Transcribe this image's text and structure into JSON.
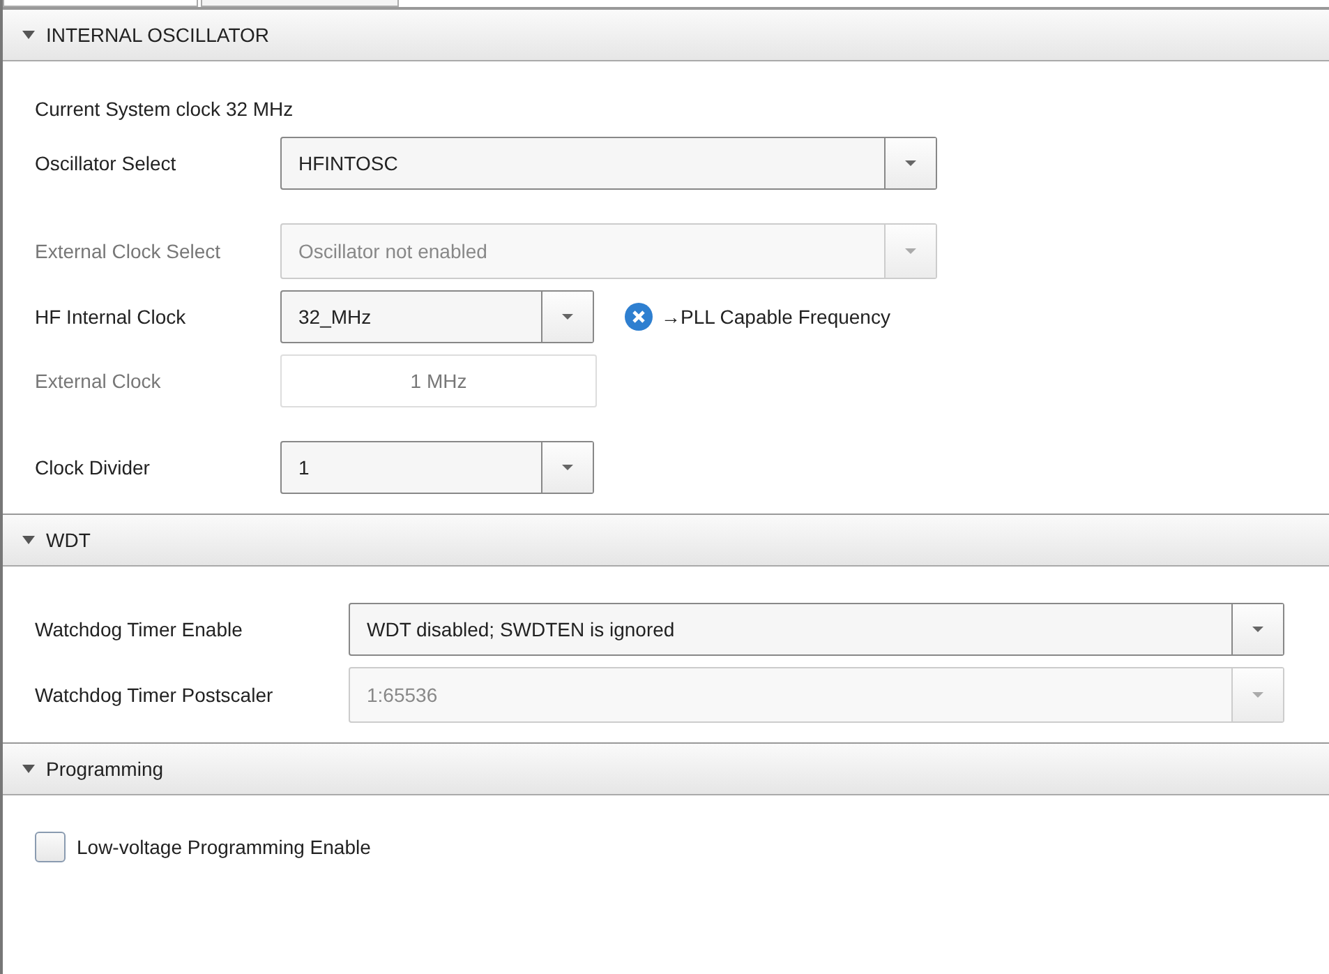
{
  "sections": [
    {
      "title": "INTERNAL OSCILLATOR",
      "expanded": true,
      "rows": [
        {
          "kind": "text",
          "label": "Current System clock",
          "value": "32 MHz"
        },
        {
          "kind": "combo",
          "label": "Oscillator Select",
          "value": "HFINTOSC",
          "disabled": false,
          "label_disabled": false
        },
        {
          "kind": "spacer"
        },
        {
          "kind": "combo",
          "label": "External Clock Select",
          "value": "Oscillator not enabled",
          "disabled": true,
          "label_disabled": true
        },
        {
          "kind": "combo",
          "label": "HF Internal Clock",
          "value": "32_MHz",
          "disabled": false,
          "label_disabled": false,
          "note": "→PLL Capable Frequency"
        },
        {
          "kind": "input",
          "label": "External Clock",
          "value": "1 MHz",
          "disabled": true,
          "label_disabled": true
        },
        {
          "kind": "spacer"
        },
        {
          "kind": "combo",
          "label": "Clock Divider",
          "value": "1",
          "disabled": false,
          "label_disabled": false
        }
      ]
    },
    {
      "title": "WDT",
      "expanded": true,
      "rows": [
        {
          "kind": "spacer"
        },
        {
          "kind": "combo",
          "label": "Watchdog Timer Enable",
          "value": "WDT disabled; SWDTEN is ignored",
          "disabled": false,
          "label_disabled": false
        },
        {
          "kind": "combo",
          "label": "Watchdog Timer Postscaler",
          "value": "1:65536",
          "disabled": true,
          "label_disabled": false
        }
      ]
    },
    {
      "title": "Programming",
      "expanded": true,
      "rows": [
        {
          "kind": "checkbox",
          "label": "Low-voltage Programming Enable",
          "checked": false
        }
      ]
    }
  ]
}
